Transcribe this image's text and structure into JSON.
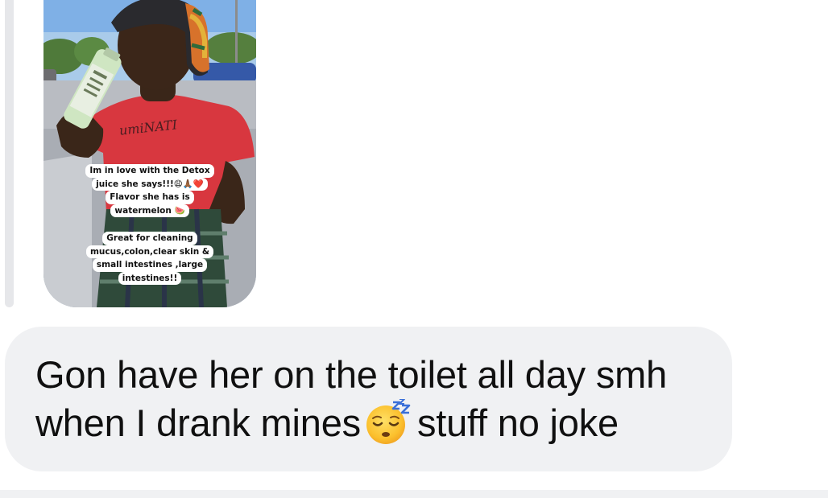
{
  "story": {
    "caption_1": [
      "Im in love with the Detox",
      "juice she says!!!😩🙏🏾❤️",
      "Flavor she has is",
      "watermelon 🍉"
    ],
    "caption_2": [
      "Great for cleaning",
      "mucus,colon,clear skin &",
      "small intestines ,large",
      "intestines!!"
    ],
    "shirt_text": "umiNATI"
  },
  "message": {
    "line_1": "Gon have her on the toilet all day smh",
    "line_2_before_emoji": "when I drank mines",
    "emoji": "sleeping-face-icon",
    "line_2_after_emoji": "stuff no joke"
  },
  "colors": {
    "bubble_bg": "#f0f1f3",
    "text": "#101010",
    "reply_line": "#e6e7ea"
  }
}
